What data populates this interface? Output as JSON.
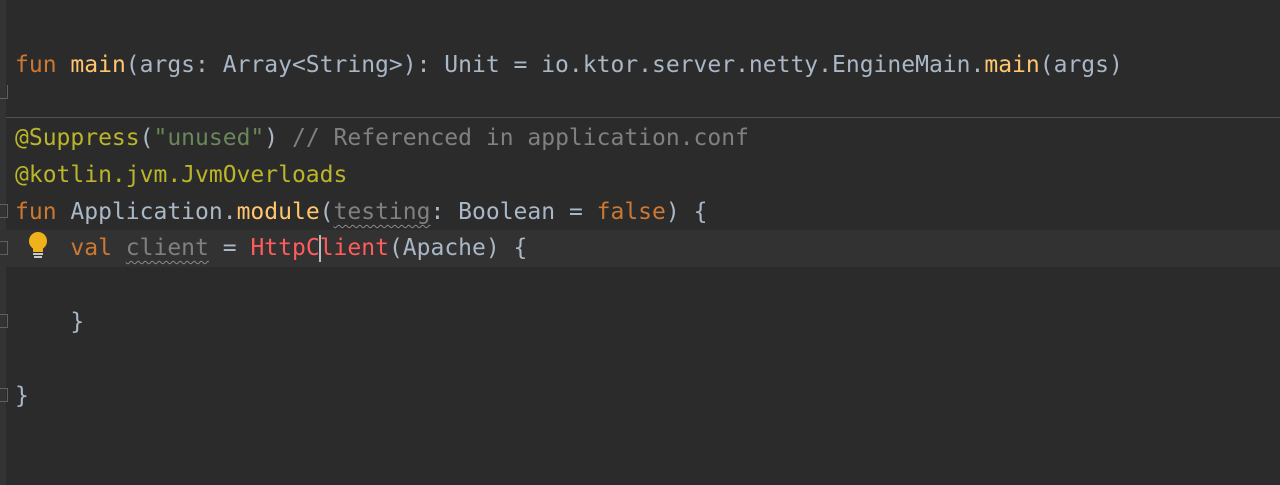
{
  "editor": {
    "language": "Kotlin",
    "colors": {
      "background": "#2b2b2b",
      "keyword": "#cc7832",
      "function": "#ffc66d",
      "string": "#6a8759",
      "comment": "#808080",
      "annotation": "#bbb529",
      "error": "#ff5c5c",
      "text": "#a9b7c6"
    },
    "lines": {
      "main": {
        "kw": "fun",
        "name": "main",
        "params": "(args: Array<String>): Unit = io.ktor.server.netty.",
        "engine": "EngineMain",
        "dot": ".",
        "call": "main",
        "tail": "(args)"
      },
      "suppress": {
        "annotation": "@Suppress",
        "open": "(",
        "string": "\"unused\"",
        "close": ")",
        "comment": "// Referenced in application.conf"
      },
      "overloads": {
        "annotation": "@kotlin.jvm.JvmOverloads"
      },
      "module": {
        "kw": "fun",
        "receiver": "Application.",
        "name": "module",
        "open": "(",
        "param": "testing",
        "mid": ": Boolean = ",
        "value": "false",
        "tail": ") {"
      },
      "client": {
        "kw": "val",
        "name": "client",
        "eq": " = ",
        "err_before_caret": "HttpC",
        "err_after_caret": "lient",
        "tail": "(Apache) {"
      },
      "inner_close": "}",
      "outer_close": "}"
    },
    "icons": {
      "intention": "lightbulb-icon",
      "fold": "fold-marker-icon"
    }
  }
}
